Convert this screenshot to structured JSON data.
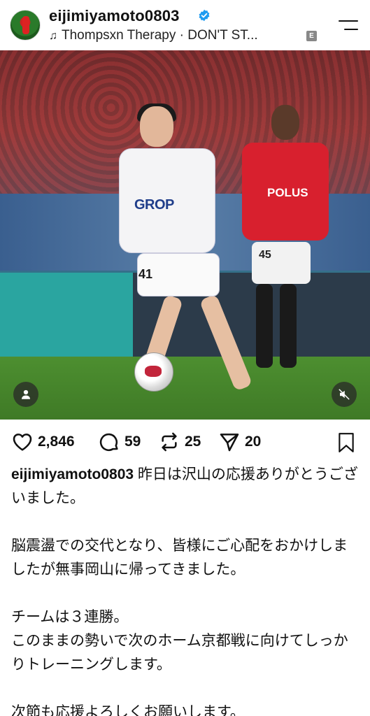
{
  "header": {
    "username": "eijimiyamoto0803",
    "music": "Thompsxn Therapy · DON'T ST...",
    "explicit_badge": "E",
    "verified_color": "#1d9bf0"
  },
  "photo": {
    "player1_sponsor": "GROP",
    "player1_number": "41",
    "player2_sponsor": "POLUS",
    "player2_number": "45"
  },
  "actions": {
    "likes": "2,846",
    "comments": "59",
    "reposts": "25",
    "shares": "20"
  },
  "caption": {
    "handle": "eijimiyamoto0803",
    "line1": " 昨日は沢山の応援ありがとうございました。",
    "line2": "脳震盪での交代となり、皆様にご心配をおかけしましたが無事岡山に帰ってきました。",
    "line3": "チームは３連勝。",
    "line4": "このままの勢いで次のホーム京都戦に向けてしっかりトレーニングします。",
    "line5": "次節も応援よろしくお願いします。"
  }
}
